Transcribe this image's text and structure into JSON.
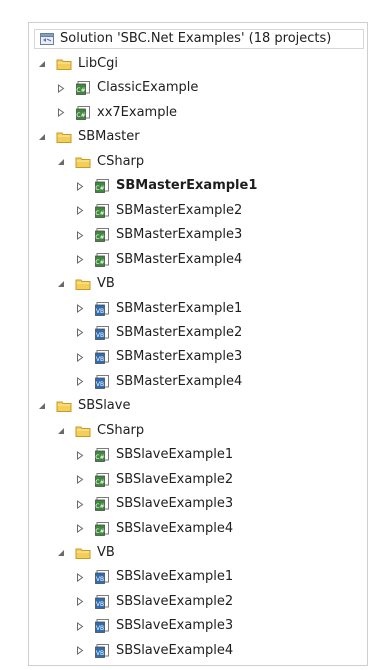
{
  "solution": {
    "label": "Solution 'SBC.Net Examples' (18 projects)",
    "icon": "solution-icon"
  },
  "tree": [
    {
      "label": "LibCgi",
      "type": "folder",
      "expanded": true,
      "level": 0
    },
    {
      "label": "ClassicExample",
      "type": "csproj",
      "expanded": false,
      "level": 1
    },
    {
      "label": "xx7Example",
      "type": "csproj",
      "expanded": false,
      "level": 1
    },
    {
      "label": "SBMaster",
      "type": "folder",
      "expanded": true,
      "level": 0
    },
    {
      "label": "CSharp",
      "type": "folder",
      "expanded": true,
      "level": 1
    },
    {
      "label": "SBMasterExample1",
      "type": "csproj",
      "expanded": false,
      "level": 2,
      "bold": true
    },
    {
      "label": "SBMasterExample2",
      "type": "csproj",
      "expanded": false,
      "level": 2
    },
    {
      "label": "SBMasterExample3",
      "type": "csproj",
      "expanded": false,
      "level": 2
    },
    {
      "label": "SBMasterExample4",
      "type": "csproj",
      "expanded": false,
      "level": 2
    },
    {
      "label": "VB",
      "type": "folder",
      "expanded": true,
      "level": 1
    },
    {
      "label": "SBMasterExample1",
      "type": "vbproj",
      "expanded": false,
      "level": 2
    },
    {
      "label": "SBMasterExample2",
      "type": "vbproj",
      "expanded": false,
      "level": 2
    },
    {
      "label": "SBMasterExample3",
      "type": "vbproj",
      "expanded": false,
      "level": 2
    },
    {
      "label": "SBMasterExample4",
      "type": "vbproj",
      "expanded": false,
      "level": 2
    },
    {
      "label": "SBSlave",
      "type": "folder",
      "expanded": true,
      "level": 0
    },
    {
      "label": "CSharp",
      "type": "folder",
      "expanded": true,
      "level": 1
    },
    {
      "label": "SBSlaveExample1",
      "type": "csproj",
      "expanded": false,
      "level": 2
    },
    {
      "label": "SBSlaveExample2",
      "type": "csproj",
      "expanded": false,
      "level": 2
    },
    {
      "label": "SBSlaveExample3",
      "type": "csproj",
      "expanded": false,
      "level": 2
    },
    {
      "label": "SBSlaveExample4",
      "type": "csproj",
      "expanded": false,
      "level": 2
    },
    {
      "label": "VB",
      "type": "folder",
      "expanded": true,
      "level": 1
    },
    {
      "label": "SBSlaveExample1",
      "type": "vbproj",
      "expanded": false,
      "level": 2
    },
    {
      "label": "SBSlaveExample2",
      "type": "vbproj",
      "expanded": false,
      "level": 2
    },
    {
      "label": "SBSlaveExample3",
      "type": "vbproj",
      "expanded": false,
      "level": 2
    },
    {
      "label": "SBSlaveExample4",
      "type": "vbproj",
      "expanded": false,
      "level": 2
    }
  ],
  "colors": {
    "folder": "#f3cf5a",
    "folder_edge": "#c99a22",
    "csproj": "#3f8a3a",
    "vbproj": "#2f6db3",
    "arrow": "#6a6a6a"
  }
}
